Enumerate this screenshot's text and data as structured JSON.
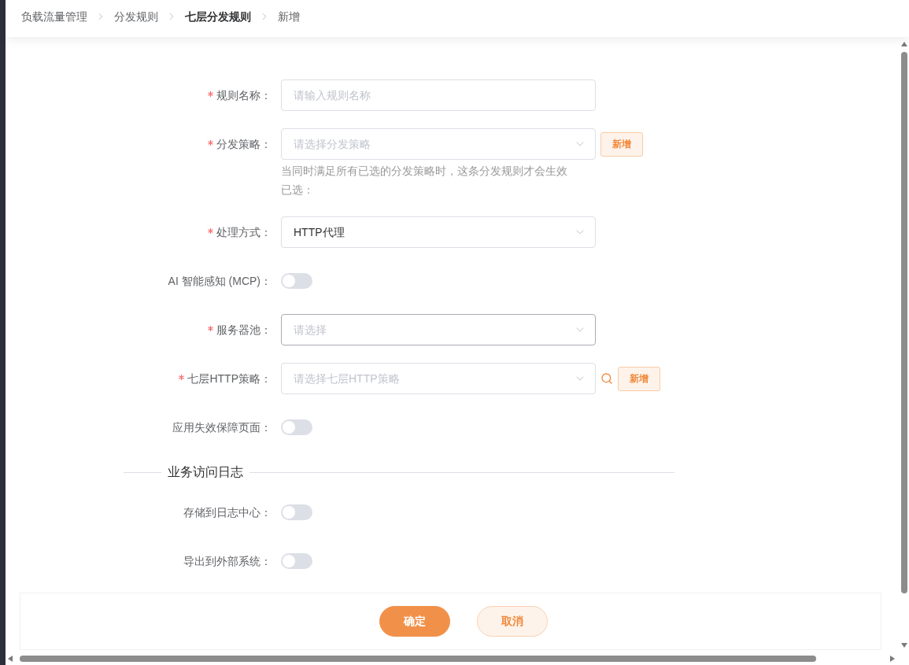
{
  "breadcrumb": [
    {
      "label": "负载流量管理",
      "active": false
    },
    {
      "label": "分发规则",
      "active": false
    },
    {
      "label": "七层分发规则",
      "active": true
    },
    {
      "label": "新增",
      "active": false
    }
  ],
  "form": {
    "fields": [
      {
        "kind": "input",
        "label": "规则名称：",
        "required": true,
        "placeholder": "请输入规则名称",
        "focused": false,
        "search": false
      },
      {
        "kind": "select",
        "label": "分发策略：",
        "required": true,
        "placeholder": "请选择分发策略",
        "focused": false,
        "search": false,
        "add_button": "新增",
        "hints": [
          "当同时满足所有已选的分发策略时，这条分发规则才会生效",
          "已选："
        ]
      },
      {
        "kind": "select",
        "label": "处理方式：",
        "required": true,
        "value": "HTTP代理",
        "focused": false,
        "search": false
      },
      {
        "kind": "switch",
        "label": "AI 智能感知 (MCP)：",
        "required": false,
        "on": false
      },
      {
        "kind": "select",
        "label": "服务器池：",
        "required": true,
        "placeholder": "请选择",
        "focused": true,
        "search": false
      },
      {
        "kind": "select",
        "label": "七层HTTP策略：",
        "required": true,
        "placeholder": "请选择七层HTTP策略",
        "focused": false,
        "search": true,
        "add_button": "新增"
      },
      {
        "kind": "switch",
        "label": "应用失效保障页面：",
        "required": false,
        "on": false
      }
    ]
  },
  "log_section": {
    "title": "业务访问日志",
    "fields": [
      {
        "kind": "switch",
        "label": "存储到日志中心：",
        "required": false,
        "on": false
      },
      {
        "kind": "switch",
        "label": "导出到外部系统：",
        "required": false,
        "on": false
      }
    ]
  },
  "buttons": [
    {
      "label": "确定",
      "kind": "primary"
    },
    {
      "label": "取消",
      "kind": "secondary"
    }
  ]
}
